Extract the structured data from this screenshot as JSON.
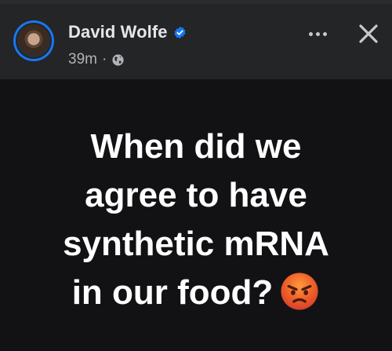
{
  "header": {
    "author_name": "David Wolfe",
    "timestamp": "39m",
    "separator": "·",
    "audience_icon": "globe-icon",
    "verified_icon": "verified-badge-icon",
    "more_icon": "more-options-icon",
    "close_icon": "close-icon"
  },
  "post": {
    "line1": "When did we",
    "line2": "agree to have",
    "line3": "synthetic mRNA",
    "line4": "in our food?",
    "emoji": "angry-face-emoji"
  },
  "colors": {
    "header_bg": "#242526",
    "post_bg": "#121214",
    "accent_blue": "#1877f2",
    "name_text": "#e4e6eb",
    "meta_text": "#b0b3b8"
  }
}
